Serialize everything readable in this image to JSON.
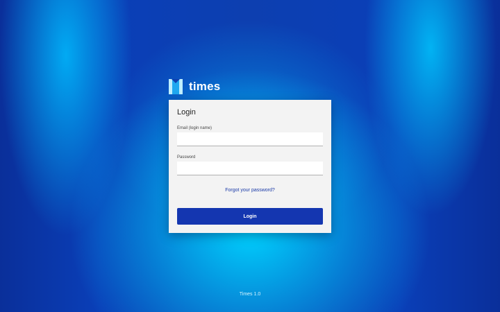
{
  "brand": {
    "name": "times",
    "logo_icon": "times-logo-icon"
  },
  "login_card": {
    "title": "Login",
    "email_label": "Email (login name)",
    "email_value": "",
    "password_label": "Password",
    "password_value": "",
    "forgot_link": "Forgot your password?",
    "login_button": "Login"
  },
  "footer": {
    "version": "Times 1.0"
  },
  "colors": {
    "accent": "#1436b0",
    "card_bg": "#f3f3f3",
    "link": "#1a3aa8"
  }
}
